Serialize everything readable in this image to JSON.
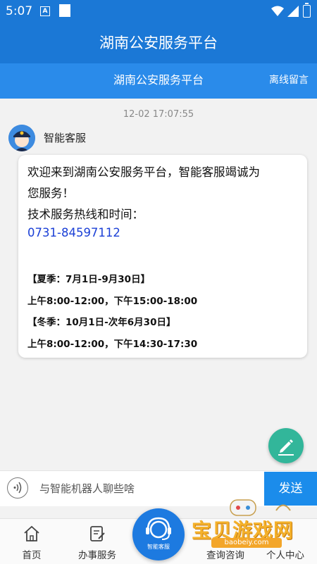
{
  "status_bar": {
    "time": "5:07",
    "notif_letter": "A"
  },
  "header": {
    "title": "湖南公安服务平台"
  },
  "subheader": {
    "title": "湖南公安服务平台",
    "right_link": "离线留言"
  },
  "chat": {
    "timestamp": "12-02 17:07:55",
    "agent_name": "智能客服",
    "message": {
      "line1": "欢迎来到湖南公安服务平台，智能客服竭诚为",
      "line2": "您服务！",
      "line3": "技术服务热线和时间：",
      "phone": "0731-84597112",
      "summer_label": "【夏季：7月1日-9月30日】",
      "summer_hours": "上午8:00-12:00，下午15:00-18:00",
      "winter_label": "【冬季：10月1日-次年6月30日】",
      "winter_hours": "上午8:00-12:00，下午14:30-17:30"
    }
  },
  "input": {
    "placeholder": "与智能机器人聊些啥",
    "send_label": "发送"
  },
  "tabs": [
    {
      "label": "首页"
    },
    {
      "label": "办事服务"
    },
    {
      "label": "智能客服"
    },
    {
      "label": "查询咨询"
    },
    {
      "label": "个人中心"
    }
  ],
  "watermark": {
    "text": "宝贝游戏网",
    "url": "baobeiy.com"
  },
  "colors": {
    "primary": "#1b78d6",
    "subheader": "#2a8bea",
    "send": "#1b8ceb",
    "fab": "#32b69a",
    "phone_link": "#1a3fd6"
  }
}
